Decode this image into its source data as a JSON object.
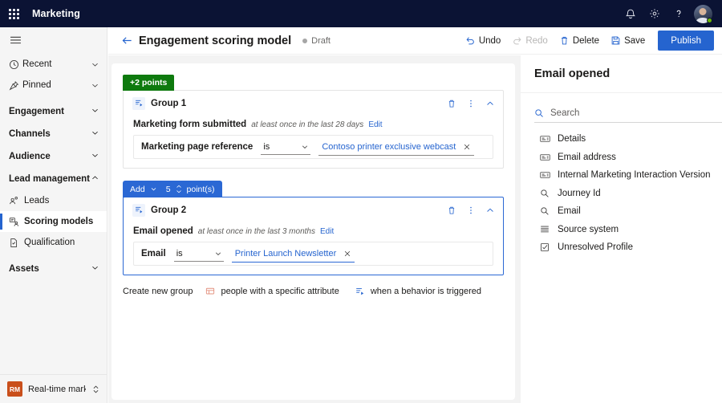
{
  "topbar": {
    "app_launcher": "waffle-icon",
    "brand": "Marketing",
    "notifications_icon": "bell-icon",
    "settings_icon": "gear-icon",
    "help_icon": "question-icon",
    "avatar": "user-avatar"
  },
  "sidebar": {
    "menu_toggle": "hamburger-icon",
    "items": [
      {
        "label": "Recent",
        "icon": "clock-icon",
        "type": "item",
        "expandable": true
      },
      {
        "label": "Pinned",
        "icon": "pin-icon",
        "type": "item",
        "expandable": true
      },
      {
        "label": "Engagement",
        "type": "group",
        "expanded": false
      },
      {
        "label": "Channels",
        "type": "group",
        "expanded": false
      },
      {
        "label": "Audience",
        "type": "group",
        "expanded": false
      },
      {
        "label": "Lead management",
        "type": "group",
        "expanded": true
      },
      {
        "label": "Leads",
        "icon": "leads-icon",
        "type": "sub",
        "selected": false
      },
      {
        "label": "Scoring models",
        "icon": "scoring-icon",
        "type": "sub",
        "selected": true
      },
      {
        "label": "Qualification",
        "icon": "qualification-icon",
        "type": "sub",
        "selected": false
      },
      {
        "label": "Assets",
        "type": "group",
        "expanded": false
      }
    ],
    "user": {
      "initials": "RM",
      "name": "Real-time marketi...",
      "switch_icon": "chevron-updown-icon"
    }
  },
  "commandbar": {
    "back_icon": "arrow-left-icon",
    "title": "Engagement scoring model",
    "status": "Draft",
    "buttons": [
      {
        "label": "Undo",
        "icon": "undo-icon",
        "disabled": false
      },
      {
        "label": "Redo",
        "icon": "redo-icon",
        "disabled": true
      },
      {
        "label": "Delete",
        "icon": "trash-icon",
        "disabled": false
      },
      {
        "label": "Save",
        "icon": "save-icon",
        "disabled": false
      }
    ],
    "publish_label": "Publish"
  },
  "canvas": {
    "group1": {
      "points_tag": "+2 points",
      "icon": "behavior-trigger-icon",
      "name": "Group 1",
      "delete_icon": "trash-icon",
      "more_icon": "more-vertical-icon",
      "collapse_icon": "chevron-up-icon",
      "trigger_name": "Marketing form submitted",
      "trigger_frequency": "at least once in the last 28 days",
      "edit_label": "Edit",
      "condition": {
        "field": "Marketing page reference",
        "operator": "is",
        "operator_chevron": "chevron-down-icon",
        "value": "Contoso printer exclusive webcast",
        "clear_icon": "close-icon"
      }
    },
    "group2": {
      "tab": {
        "action": "Add",
        "action_chevron": "chevron-down-icon",
        "points": "5",
        "stepper_icon": "spinner-updown-icon",
        "unit": "point(s)"
      },
      "icon": "behavior-trigger-icon",
      "name": "Group 2",
      "delete_icon": "trash-icon",
      "more_icon": "more-vertical-icon",
      "collapse_icon": "chevron-up-icon",
      "trigger_name": "Email opened",
      "trigger_frequency": "at least once in the last 3 months",
      "edit_label": "Edit",
      "condition": {
        "field": "Email",
        "operator": "is",
        "operator_chevron": "chevron-down-icon",
        "value": "Printer Launch Newsletter",
        "clear_icon": "close-icon"
      }
    },
    "create": {
      "label": "Create new group",
      "options": [
        {
          "label": "people with a specific attribute",
          "icon": "attribute-group-icon"
        },
        {
          "label": "when a behavior is triggered",
          "icon": "behavior-trigger-icon"
        }
      ]
    }
  },
  "right_panel": {
    "title": "Email opened",
    "collapse_icon": "collapse-panel-icon",
    "search_placeholder": "Search",
    "search_value": "",
    "search_icon": "search-icon",
    "attributes": [
      {
        "label": "Details",
        "icon": "text-field-icon"
      },
      {
        "label": "Email address",
        "icon": "text-field-icon"
      },
      {
        "label": "Internal Marketing Interaction Version",
        "icon": "text-field-icon"
      },
      {
        "label": "Journey Id",
        "icon": "lookup-icon"
      },
      {
        "label": "Email",
        "icon": "lookup-icon"
      },
      {
        "label": "Source system",
        "icon": "list-icon"
      },
      {
        "label": "Unresolved Profile",
        "icon": "checkbox-icon"
      }
    ]
  },
  "rail": {
    "buttons": [
      {
        "icon": "add-box-icon",
        "active": false
      },
      {
        "icon": "list-properties-icon",
        "active": false
      },
      {
        "icon": "key-icon",
        "active": false
      },
      {
        "icon": "behavior-trigger-icon",
        "active": true
      }
    ]
  },
  "colors": {
    "brand_bar": "#0b1334",
    "accent_blue": "#2564cf",
    "tab_blue": "#2b68d4",
    "points_green": "#0e7a0e",
    "canvas_gray": "#f3f3f3",
    "sidebar_gray": "#f5f5f5",
    "user_tile_orange": "#c94f1b"
  }
}
